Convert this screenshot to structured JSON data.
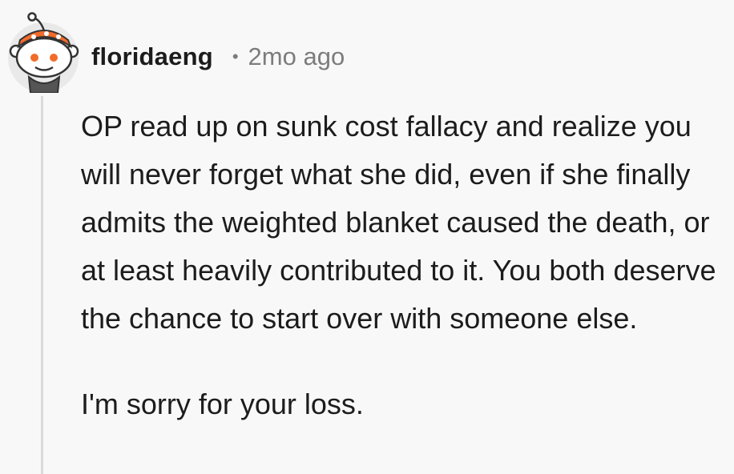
{
  "comment": {
    "avatar_icon": "reddit-snoo-avatar-icon",
    "username": "floridaeng",
    "separator": "•",
    "timestamp": "2mo ago",
    "paragraphs": [
      "OP read up on sunk cost fallacy and realize you will never forget what she did, even if she finally admits the weighted blanket caused the death, or at least heavily contributed to it. You both deserve the chance to start over with someone else.",
      "I'm sorry for your loss."
    ]
  },
  "colors": {
    "background": "#f8f8f8",
    "text": "#1c1c1c",
    "meta": "#7c7c7c",
    "thread_line": "#dadada",
    "headband": "#f26b2a"
  }
}
